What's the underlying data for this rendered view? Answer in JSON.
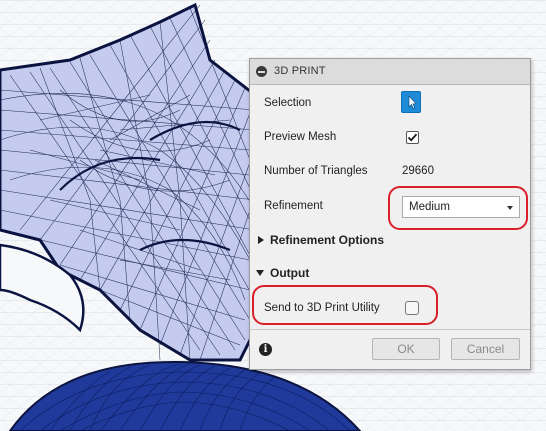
{
  "dialog": {
    "title": "3D PRINT",
    "selection_label": "Selection",
    "preview_mesh_label": "Preview Mesh",
    "preview_mesh_checked": true,
    "triangles_label": "Number of Triangles",
    "triangles_value": "29660",
    "refinement_label": "Refinement",
    "refinement_value": "Medium",
    "refinement_options_label": "Refinement Options",
    "output_label": "Output",
    "send_label": "Send to 3D Print Utility",
    "send_checked": false,
    "ok_label": "OK",
    "cancel_label": "Cancel",
    "info_glyph": "i"
  },
  "colors": {
    "highlight": "#d8202a",
    "selection_button": "#1f8bd6",
    "mesh_fill": "#c8cdf2",
    "mesh_dark": "#1a2a78"
  },
  "icons": {
    "collapse": "collapse-icon",
    "pointer": "pointer-icon",
    "info": "info-icon"
  }
}
